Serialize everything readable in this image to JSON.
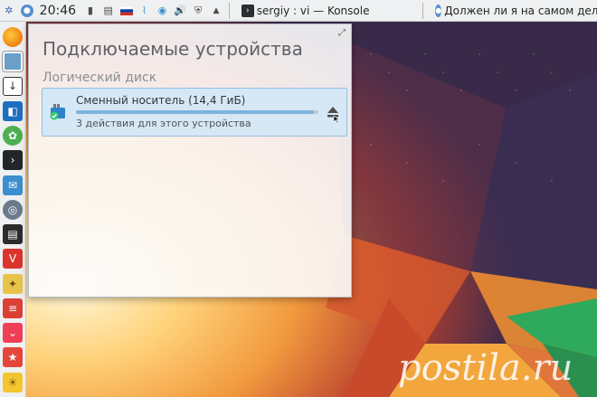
{
  "top_panel": {
    "clock": "20:46",
    "tasks": [
      {
        "label": "sergiy : vi — Konsole"
      },
      {
        "label": "Должен ли я на самом деле"
      }
    ]
  },
  "popup": {
    "title": "Подключаемые устройства",
    "section_header": "Логический диск",
    "device": {
      "name": "Сменный носитель (14,4 ГиБ)",
      "actions": "3 действия для этого устройства",
      "usage_fraction": 0.98
    }
  },
  "watermark": "postila.ru",
  "colors": {
    "panel": "#eff0f1",
    "accent": "#3daee9",
    "selection": "#d6e7f5"
  }
}
